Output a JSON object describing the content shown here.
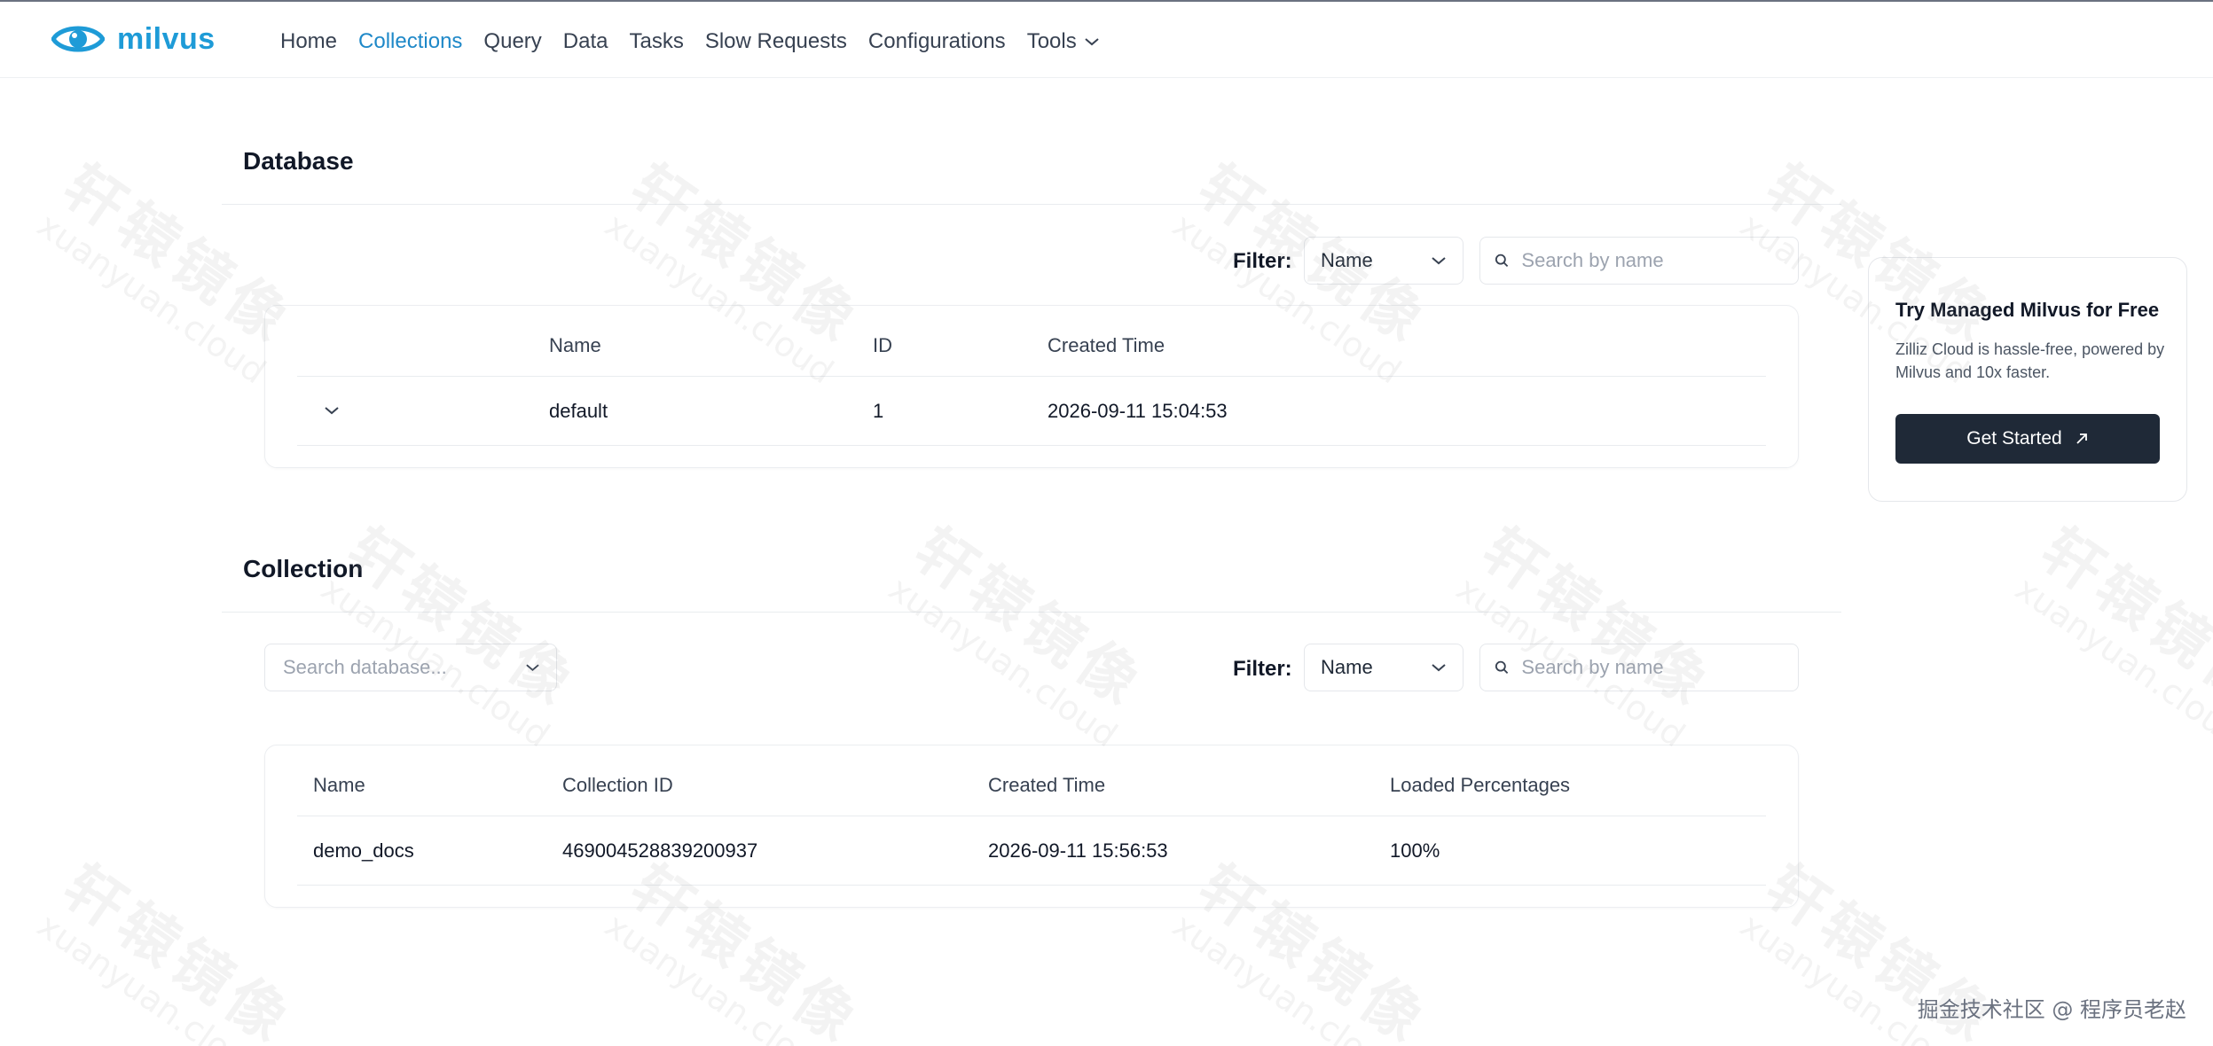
{
  "app": {
    "logo_text": "milvus",
    "brand_color": "#1e9bd7"
  },
  "nav": {
    "items": [
      {
        "label": "Home",
        "active": false
      },
      {
        "label": "Collections",
        "active": true
      },
      {
        "label": "Query",
        "active": false
      },
      {
        "label": "Data",
        "active": false
      },
      {
        "label": "Tasks",
        "active": false
      },
      {
        "label": "Slow Requests",
        "active": false
      },
      {
        "label": "Configurations",
        "active": false
      },
      {
        "label": "Tools",
        "active": false
      }
    ],
    "active_color": "#1e88c8"
  },
  "database": {
    "title": "Database",
    "filter_label": "Filter:",
    "filter_value": "Name",
    "search_placeholder": "Search by name",
    "columns": [
      "Name",
      "ID",
      "Created Time"
    ],
    "rows": [
      {
        "name": "default",
        "id": "1",
        "created": "2026-09-11 15:04:53"
      }
    ]
  },
  "collection": {
    "title": "Collection",
    "db_select_placeholder": "Search database...",
    "filter_label": "Filter:",
    "filter_value": "Name",
    "search_placeholder": "Search by name",
    "columns": [
      "Name",
      "Collection ID",
      "Created Time",
      "Loaded Percentages"
    ],
    "rows": [
      {
        "name": "demo_docs",
        "collection_id": "469004528839200937",
        "created": "2026-09-11 15:56:53",
        "loaded": "100%"
      }
    ]
  },
  "promo": {
    "title": "Try Managed Milvus for Free",
    "description": "Zilliz Cloud is hassle-free, powered by Milvus and 10x faster.",
    "button_label": "Get Started",
    "button_color": "#1f2937"
  },
  "watermark": {
    "cn": "轩辕镜像",
    "en": "xuanyuan.cloud"
  },
  "credit": "掘金技术社区 @ 程序员老赵"
}
